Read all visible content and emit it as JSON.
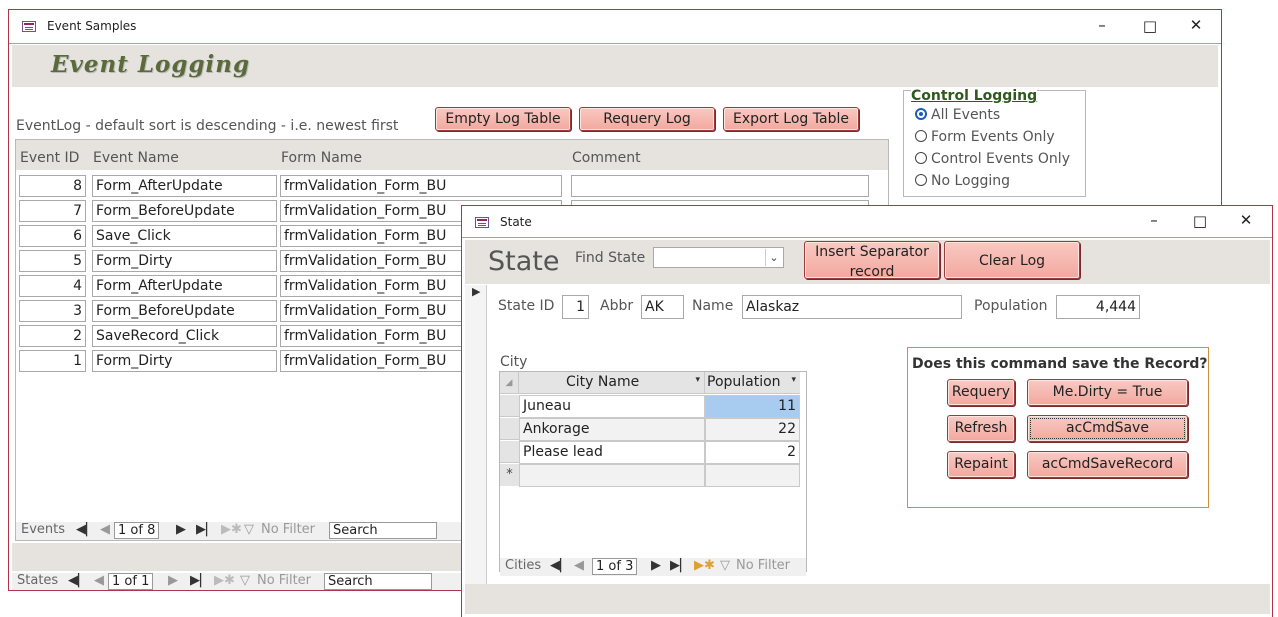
{
  "event_window": {
    "title": "Event Samples",
    "heading": "Event Logging",
    "caption": "EventLog - default sort is descending - i.e. newest first",
    "buttons": {
      "empty": "Empty Log Table",
      "requery": "Requery Log",
      "export": "Export Log Table"
    },
    "columns": [
      "Event ID",
      "Event Name",
      "Form Name",
      "Comment"
    ],
    "rows": [
      {
        "id": "8",
        "event": "Form_AfterUpdate",
        "form": "frmValidation_Form_BU",
        "comment": ""
      },
      {
        "id": "7",
        "event": "Form_BeforeUpdate",
        "form": "frmValidation_Form_BU",
        "comment": ""
      },
      {
        "id": "6",
        "event": "Save_Click",
        "form": "frmValidation_Form_BU",
        "comment": ""
      },
      {
        "id": "5",
        "event": "Form_Dirty",
        "form": "frmValidation_Form_BU",
        "comment": ""
      },
      {
        "id": "4",
        "event": "Form_AfterUpdate",
        "form": "frmValidation_Form_BU",
        "comment": ""
      },
      {
        "id": "3",
        "event": "Form_BeforeUpdate",
        "form": "frmValidation_Form_BU",
        "comment": ""
      },
      {
        "id": "2",
        "event": "SaveRecord_Click",
        "form": "frmValidation_Form_BU",
        "comment": ""
      },
      {
        "id": "1",
        "event": "Form_Dirty",
        "form": "frmValidation_Form_BU",
        "comment": ""
      }
    ],
    "events_nav": {
      "label": "Events",
      "record": "1 of 8",
      "filter": "No Filter",
      "search": "Search"
    },
    "states_nav": {
      "label": "States",
      "record": "1 of 1",
      "filter": "No Filter",
      "search": "Search"
    },
    "control_logging": {
      "title": "Control Logging",
      "options": [
        "All Events",
        "Form Events Only",
        "Control Events Only",
        "No Logging"
      ],
      "selected": "All Events"
    }
  },
  "state_window": {
    "title": "State",
    "heading": "State",
    "find_label": "Find State",
    "find_value": "",
    "buttons": {
      "insert_separator": "Insert Separator record",
      "clear_log": "Clear Log"
    },
    "fields": {
      "state_id_label": "State ID",
      "state_id": "1",
      "abbr_label": "Abbr",
      "abbr": "AK",
      "name_label": "Name",
      "name": "Alaskaz",
      "population_label": "Population",
      "population": "4,444"
    },
    "city_label": "City",
    "city_columns": [
      "City Name",
      "Population"
    ],
    "city_rows": [
      {
        "name": "Juneau",
        "population": "11"
      },
      {
        "name": "Ankorage",
        "population": "22"
      },
      {
        "name": "Please lead",
        "population": "2"
      }
    ],
    "cities_nav": {
      "label": "Cities",
      "record": "1 of 3",
      "filter": "No Filter"
    },
    "save_panel": {
      "title": "Does this command save the Record?",
      "buttons": [
        "Requery",
        "Me.Dirty = True",
        "Refresh",
        "acCmdSave",
        "Repaint",
        "acCmdSaveRecord"
      ]
    }
  },
  "colors": {
    "accent_border": "#b0334a",
    "button_fill": "#f2a89f",
    "band": "#e6e3df",
    "selection": "#a8ccf0"
  }
}
